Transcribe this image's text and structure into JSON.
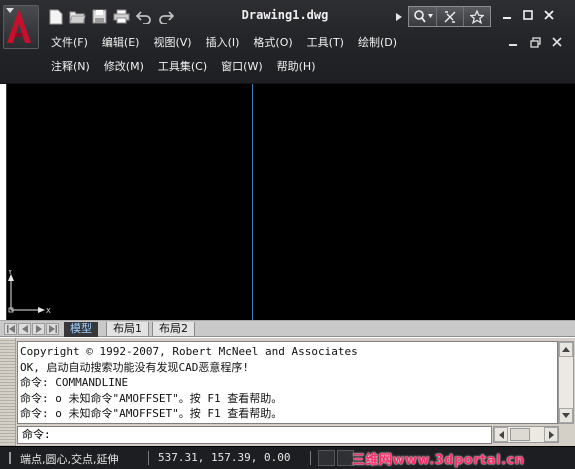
{
  "window": {
    "title": "Drawing1.dwg"
  },
  "icons": {
    "app_logo": "autocad-logo-icon",
    "qat": [
      "new-file-icon",
      "open-folder-icon",
      "save-icon",
      "print-icon",
      "undo-icon",
      "redo-icon"
    ],
    "help": [
      "search-icon",
      "communication-center-icon",
      "favorites-star-icon"
    ],
    "window_controls": [
      "minimize-icon",
      "maximize-icon",
      "close-icon"
    ]
  },
  "menu": {
    "row1": [
      {
        "label": "文件(F)"
      },
      {
        "label": "编辑(E)"
      },
      {
        "label": "视图(V)"
      },
      {
        "label": "插入(I)"
      },
      {
        "label": "格式(O)"
      },
      {
        "label": "工具(T)"
      },
      {
        "label": "绘制(D)"
      }
    ],
    "row2": [
      {
        "label": "注释(N)"
      },
      {
        "label": "修改(M)"
      },
      {
        "label": "工具集(C)"
      },
      {
        "label": "窗口(W)"
      },
      {
        "label": "帮助(H)"
      }
    ]
  },
  "ucs": {
    "x_label": "X",
    "y_label": "Y"
  },
  "tabs": [
    {
      "label": "模型",
      "active": true
    },
    {
      "label": "布局1",
      "active": false
    },
    {
      "label": "布局2",
      "active": false
    }
  ],
  "command": {
    "history": [
      "Copyright © 1992-2007, Robert McNeel and Associates",
      "OK, 启动自动搜索功能没有发现CAD恶意程序!",
      "命令: COMMANDLINE",
      "命令: o 未知命令\"AMOFFSET\"。按 F1 查看帮助。",
      "命令: o 未知命令\"AMOFFSET\"。按 F1 查看帮助。"
    ],
    "prompt": "命令:"
  },
  "status": {
    "osnap": "端点,圆心,交点,延伸",
    "coordinates": "537.31, 157.39, 0.00",
    "watermark": "三维网www.3dportal.cn"
  },
  "colors": {
    "titlebar": "#242528",
    "drawing_background": "#000000",
    "viewport_divider": "#3d7fb4",
    "logo_red": "#c8102e",
    "watermark": "#ff2a6a"
  }
}
